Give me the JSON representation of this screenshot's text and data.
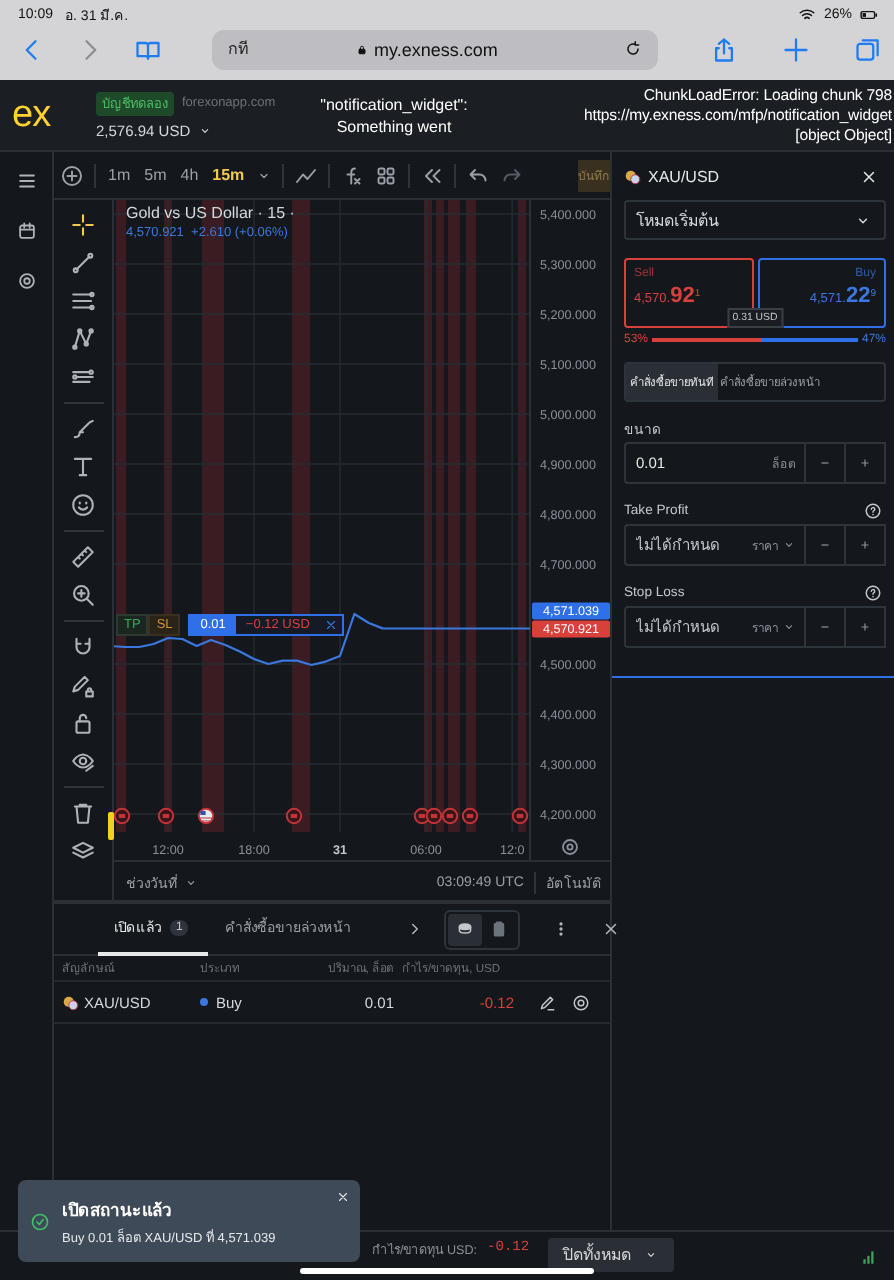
{
  "browser": {
    "time": "10:09",
    "date": "อ. 31 มี.ค.",
    "battery": "26%",
    "page_text": "กที",
    "address": "my.exness.com"
  },
  "header": {
    "logo": "ex",
    "account_badge": "บัญชีทดลอง",
    "server": "forexonapp.com",
    "balance": "2,576.94 USD",
    "widget_error": [
      "\"notification_widget\":",
      "Something went"
    ],
    "chunk_error": [
      "ChunkLoadError: Loading chunk 798",
      "https://my.exness.com/mfp/notification_widget",
      "[object Object]"
    ]
  },
  "toolbar": {
    "timeframes": [
      {
        "label": "1m",
        "selected": false
      },
      {
        "label": "5m",
        "selected": false
      },
      {
        "label": "4h",
        "selected": false
      },
      {
        "label": "15m",
        "selected": true
      }
    ],
    "save_label": "บันทึก"
  },
  "chart": {
    "quote": "4,570.921  +2.610 (+0.06%)",
    "ask_tag": "4,571.039",
    "bid_tag": "4,570.921",
    "order": {
      "tp": "TP",
      "sl": "SL",
      "volume": "0.01",
      "pnl": "−0.12 USD"
    },
    "chart_data": {
      "type": "line",
      "title": "Gold vs US Dollar · 15 ·",
      "categories": [
        null,
        null,
        null,
        null,
        "12:00",
        null,
        null,
        null,
        null,
        null,
        "18:00",
        null,
        null,
        null,
        null,
        null,
        "31",
        null,
        null,
        null,
        null,
        null,
        "06:00",
        null,
        null,
        null,
        null,
        null,
        "12:0"
      ],
      "series": [
        {
          "color": "#3a78e0",
          "values": [
            4536,
            4534,
            4534,
            4540,
            4552,
            4550,
            4536,
            4548,
            4538,
            4525,
            4510,
            4500,
            4507,
            4507,
            4498,
            4505,
            4516,
            4600,
            4582,
            4571,
            null,
            null,
            null,
            null,
            null,
            null,
            null,
            null,
            null
          ]
        }
      ],
      "ylim": [
        4200,
        5400
      ],
      "grid": true,
      "yticks": [
        {
          "value": 5400,
          "label": "5,400.000"
        },
        {
          "value": 5300,
          "label": "5,300.000"
        },
        {
          "value": 5200,
          "label": "5,200.000"
        },
        {
          "value": 5100,
          "label": "5,100.000"
        },
        {
          "value": 5000,
          "label": "5,000.000"
        },
        {
          "value": 4900,
          "label": "4,900.000"
        },
        {
          "value": 4800,
          "label": "4,800.000"
        },
        {
          "value": 4700,
          "label": "4,700.000"
        },
        {
          "value": 4500,
          "label": "4,500.000"
        },
        {
          "value": 4400,
          "label": "4,400.000"
        },
        {
          "value": 4300,
          "label": "4,300.000"
        },
        {
          "value": 4200,
          "label": "4,200.000"
        }
      ]
    },
    "range_label": "ช่วงวันที่",
    "clock": "03:09:49 UTC",
    "scale_mode": "อัตโนมัติ"
  },
  "panel": {
    "symbol": "XAU/USD",
    "mode": "โหมดเริ่มต้น",
    "sell": {
      "label": "Sell",
      "price": "4,570.**92**$^{1}$"
    },
    "buy": {
      "label": "Buy",
      "price": "4,571.**22**$^{9}$"
    },
    "spread": "0.31 USD",
    "sentiment": {
      "sell_pct": "53%",
      "buy_pct": "47%",
      "level": 0.53
    },
    "order_tabs": [
      {
        "label": "คำสั่งซื้อขายทันที",
        "selected": true
      },
      {
        "label": "คำสั่งซื้อขายล่วงหน้า",
        "selected": false
      }
    ],
    "fields": [
      {
        "kind": "volume",
        "label": "ขนาด",
        "value": "0.01",
        "unit": "ล็อต",
        "help": false
      },
      {
        "kind": "price",
        "label": "Take Profit",
        "placeholder": "ไม่ได้กำหนด",
        "unit": "ราคา",
        "help": true
      },
      {
        "kind": "price",
        "label": "Stop Loss",
        "placeholder": "ไม่ได้กำหนด",
        "unit": "ราคา",
        "help": true
      }
    ]
  },
  "orders": {
    "tabs": [
      {
        "label": "เปิดแล้ว",
        "count": "1",
        "selected": true
      },
      {
        "label": "คำสั่งซื้อขายล่วงหน้า",
        "selected": false
      }
    ],
    "view_toggle": [
      {
        "selected": true
      },
      {
        "selected": false
      }
    ],
    "columns": [
      "สัญลักษณ์",
      "ประเภท",
      "ปริมาณ, ล็อต",
      "กำไร/ขาดทุน, USD"
    ],
    "rows": [
      {
        "symbol": "XAU/USD",
        "type": "Buy",
        "volume": "0.01",
        "pnl": "-0.12"
      }
    ]
  },
  "footer": {
    "pnl_label": "กำไร/ขาดทุน USD:",
    "pnl": "-0.12",
    "close_all": "ปิดทั้งหมด"
  },
  "toast": {
    "title": "เปิดสถานะแล้ว",
    "message": "Buy 0.01 ล็อต XAU/USD ที่ 4,571.039"
  }
}
